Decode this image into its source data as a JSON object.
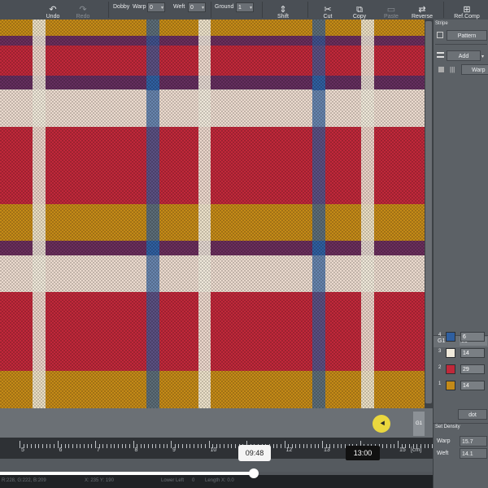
{
  "toolbar": {
    "undo": "Undo",
    "redo": "Redo",
    "dobby": "Dobby",
    "warp": "Warp",
    "warp_value": "0",
    "weft": "Weft",
    "weft_value": "0",
    "ground": "Ground",
    "ground_value": "1",
    "shift": "Shift",
    "cut": "Cut",
    "copy": "Copy",
    "paste": "Paste",
    "reverse": "Reverse",
    "refcomp": "Ref.Comp"
  },
  "icons": {
    "undo": "↶",
    "redo": "↷",
    "shift": "⇕",
    "cut": "✂",
    "copy": "⧉",
    "paste": "📋",
    "reverse": "⇄",
    "refcomp": "⊞"
  },
  "panel": {
    "stripe_title": "Stripe",
    "pattern_button": "Pattern",
    "add_button": "Add",
    "warp_button": "Warp",
    "group_label": "G1",
    "group_value": "63",
    "colors": [
      {
        "num": "4",
        "hex": "#2f5fa0",
        "value": "6"
      },
      {
        "num": "3",
        "hex": "#efe9db",
        "value": "14"
      },
      {
        "num": "2",
        "hex": "#c0283a",
        "value": "29"
      },
      {
        "num": "1",
        "hex": "#c48a18",
        "value": "14"
      }
    ],
    "unit_select": "dot",
    "set_density": "Set Density",
    "warp_density_label": "Warp",
    "warp_density": "15.7",
    "weft_density_label": "Weft",
    "weft_density": "14.1"
  },
  "canvas": {
    "g1_tab": "G1"
  },
  "ruler": {
    "labels": [
      "5",
      "6",
      "7",
      "8",
      "9",
      "10",
      "11",
      "12",
      "13",
      "14",
      "15"
    ],
    "unit": "[cm]"
  },
  "video": {
    "hover_time": "09:48",
    "duration_time": "13:00",
    "progress": 0.52
  },
  "status": {
    "rgb": "R:228, G:222, B:209",
    "coords": "X: 235    Y: 190",
    "lower_left": "Lower Left",
    "zero": "0",
    "length": "Length   X: 0.0"
  },
  "colors": {
    "red": "#c0283a",
    "gold": "#c48a18",
    "cream": "#efe9db",
    "blue": "#2f5fa0",
    "purple": "#5a2f63"
  }
}
